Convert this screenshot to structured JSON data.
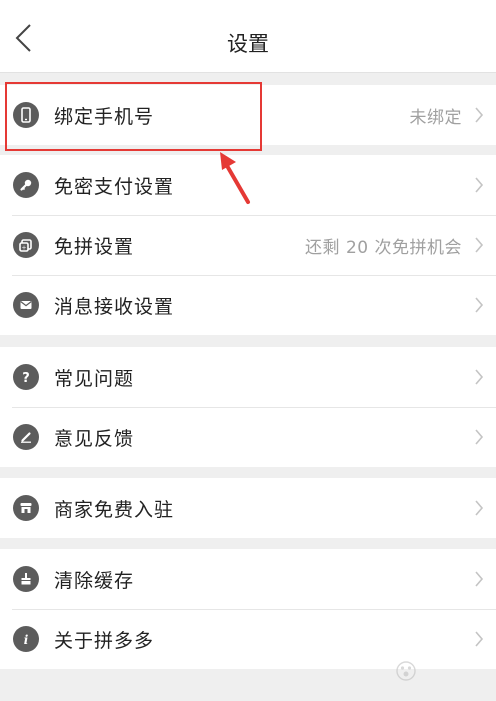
{
  "navbar": {
    "title": "设置"
  },
  "groups": [
    {
      "rows": [
        {
          "label": "绑定手机号",
          "value": "未绑定",
          "icon": "phone-icon"
        }
      ]
    },
    {
      "rows": [
        {
          "label": "免密支付设置",
          "value": "",
          "icon": "key-icon"
        },
        {
          "label": "免拼设置",
          "value": "还剩 20 次免拼机会",
          "icon": "free-group-icon"
        },
        {
          "label": "消息接收设置",
          "value": "",
          "icon": "envelope-icon"
        }
      ]
    },
    {
      "rows": [
        {
          "label": "常见问题",
          "value": "",
          "icon": "question-icon"
        },
        {
          "label": "意见反馈",
          "value": "",
          "icon": "pencil-icon"
        }
      ]
    },
    {
      "rows": [
        {
          "label": "商家免费入驻",
          "value": "",
          "icon": "store-icon"
        }
      ]
    },
    {
      "rows": [
        {
          "label": "清除缓存",
          "value": "",
          "icon": "broom-icon"
        },
        {
          "label": "关于拼多多",
          "value": "",
          "icon": "info-icon"
        }
      ]
    }
  ],
  "annotation": {
    "highlight_color": "#e53935"
  },
  "colors": {
    "background": "#efefef",
    "icon": "#5c5c5c",
    "label": "#222222",
    "value": "#a0a0a0",
    "chevron": "#c4c4c4"
  },
  "watermark": {
    "text": "Bai经验",
    "subtext": "jingyan.baidu.com"
  }
}
